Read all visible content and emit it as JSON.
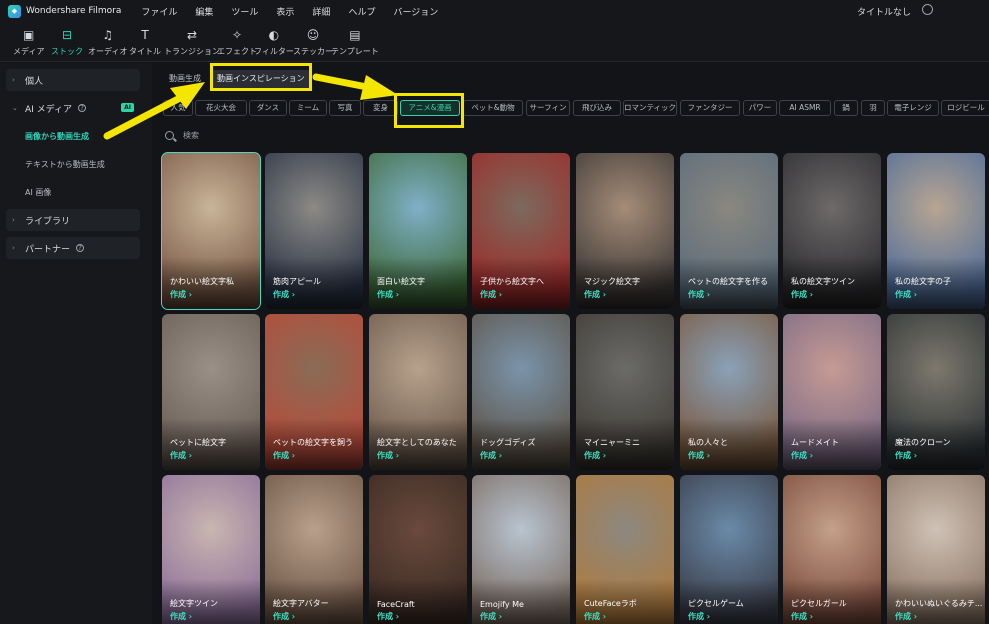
{
  "app": {
    "name": "Wondershare Filmora",
    "doc_title": "タイトルなし"
  },
  "menu": [
    "ファイル",
    "編集",
    "ツール",
    "表示",
    "詳細",
    "ヘルプ",
    "バージョン"
  ],
  "toolbar": [
    {
      "label": "メディア",
      "icon": "media-icon"
    },
    {
      "label": "ストック",
      "icon": "stock-icon",
      "active": true
    },
    {
      "label": "オーディオ",
      "icon": "audio-icon"
    },
    {
      "label": "タイトル",
      "icon": "title-icon"
    },
    {
      "label": "トランジション",
      "icon": "transition-icon"
    },
    {
      "label": "エフェクト",
      "icon": "effect-icon"
    },
    {
      "label": "フィルター",
      "icon": "filter-icon"
    },
    {
      "label": "ステッカー",
      "icon": "sticker-icon"
    },
    {
      "label": "テンプレート",
      "icon": "template-icon"
    }
  ],
  "sidebar": {
    "groups": [
      {
        "label": "個人",
        "expanded": false
      },
      {
        "label": "AI メディア",
        "expanded": true,
        "badge": "AI"
      },
      {
        "label": "ライブラリ",
        "expanded": false
      },
      {
        "label": "パートナー",
        "expanded": false
      }
    ],
    "ai_items": [
      "画像から動画生成",
      "テキストから動画生成",
      "AI 画像"
    ],
    "active_item": "画像から動画生成"
  },
  "main": {
    "tabs": [
      "動画生成",
      "動画インスピレーション"
    ],
    "selected_tab": "動画インスピレーション",
    "chips": [
      "人気",
      "花火大会",
      "ダンス",
      "ミーム",
      "写真",
      "変身",
      "アニメ&漫画",
      "ペット&動物",
      "サーフィン",
      "飛び込み",
      "ロマンティック",
      "ファンタジー",
      "パワー",
      "AI ASMR",
      "鍋",
      "羽",
      "電子レンジ",
      "ロジビール"
    ],
    "selected_chip": "アニメ&漫画",
    "search_placeholder": "検索",
    "make_label": "作成 ›",
    "cards": [
      {
        "title": "かわいい絵文字私",
        "colors": [
          "#c9b49a",
          "#7a5a45"
        ],
        "selected": true
      },
      {
        "title": "筋肉アピール",
        "colors": [
          "#8c8a86",
          "#2a3346"
        ]
      },
      {
        "title": "面白い絵文字",
        "colors": [
          "#7fb0c8",
          "#3f6a3a"
        ]
      },
      {
        "title": "子供から絵文字へ",
        "colors": [
          "#7c6a5c",
          "#9e2a2a"
        ]
      },
      {
        "title": "マジック絵文字",
        "colors": [
          "#a58c78",
          "#3c3836"
        ]
      },
      {
        "title": "ペットの絵文字を作る",
        "colors": [
          "#8a8780",
          "#5a6c7c"
        ]
      },
      {
        "title": "私の絵文字ツイン",
        "colors": [
          "#6e6a6a",
          "#2b2b2e"
        ]
      },
      {
        "title": "私の絵文字の子",
        "colors": [
          "#b7a592",
          "#4f6d9a"
        ]
      },
      {
        "title": "ペットに絵文字",
        "colors": [
          "#9a9088",
          "#6a5e55"
        ]
      },
      {
        "title": "ペットの絵文字を飼う",
        "colors": [
          "#8a6c55",
          "#b84a3a"
        ]
      },
      {
        "title": "絵文字としてのあなた",
        "colors": [
          "#b7a28c",
          "#6c5a4c"
        ]
      },
      {
        "title": "ドッグゴディズ",
        "colors": [
          "#7a94aa",
          "#5e5448"
        ]
      },
      {
        "title": "マイニャーミニ",
        "colors": [
          "#6b6b68",
          "#3f3b36"
        ]
      },
      {
        "title": "私の人々と",
        "colors": [
          "#8aa1b8",
          "#7a5a40"
        ]
      },
      {
        "title": "ムードメイト",
        "colors": [
          "#c59b94",
          "#7c6a86"
        ]
      },
      {
        "title": "魔法のクローン",
        "colors": [
          "#7c786c",
          "#2f3438"
        ]
      },
      {
        "title": "絵文字ツイン",
        "colors": [
          "#c9b6b0",
          "#8c6f9a"
        ]
      },
      {
        "title": "絵文字アバター",
        "colors": [
          "#b8a08c",
          "#6c5444"
        ]
      },
      {
        "title": "FaceCraft",
        "colors": [
          "#6a4a3c",
          "#3a2a24"
        ]
      },
      {
        "title": "Emojify Me",
        "colors": [
          "#b8c4d0",
          "#7a6a60"
        ]
      },
      {
        "title": "CuteFaceラボ",
        "colors": [
          "#8c8880",
          "#b07a3a"
        ]
      },
      {
        "title": "ピクセルゲーム",
        "colors": [
          "#6a8aa8",
          "#3a3c48"
        ]
      },
      {
        "title": "ピクセルガール",
        "colors": [
          "#c4a08a",
          "#7a4a3c"
        ]
      },
      {
        "title": "かわいいぬいぐるみチ...",
        "colors": [
          "#cfc2b6",
          "#8a7464"
        ]
      }
    ]
  }
}
